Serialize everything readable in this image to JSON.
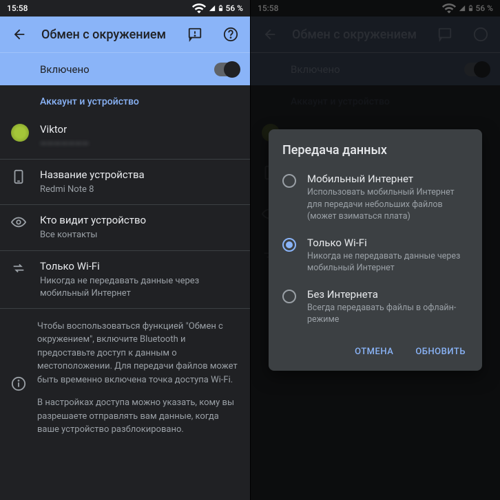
{
  "status": {
    "time": "15:58",
    "battery": "56 %"
  },
  "appbar": {
    "title": "Обмен с окружением"
  },
  "enabled": {
    "label": "Включено"
  },
  "section": {
    "account": "Аккаунт и устройство"
  },
  "rows": {
    "user": {
      "name": "Viktor",
      "email": "———————"
    },
    "device": {
      "title": "Название устройства",
      "sub": "Redmi Note 8"
    },
    "visibility": {
      "title": "Кто видит устройство",
      "sub": "Все контакты"
    },
    "datausage": {
      "title": "Только Wi-Fi",
      "sub": "Никогда не передавать данные через мобильный Интернет"
    }
  },
  "info": {
    "p1": "Чтобы воспользоваться функцией \"Обмен с окружением\", включите Bluetooth и предоставьте доступ к данным о местоположении. Для передачи файлов может быть временно включена точка доступа Wi-Fi.",
    "p2": "В настройках доступа можно указать, кому вы разрешаете отправлять вам данные, когда ваше устройство разблокировано."
  },
  "dialog": {
    "title": "Передача данных",
    "options": [
      {
        "title": "Мобильный Интернет",
        "sub": "Использовать мобильный Интернет для передачи небольших файлов\n(может взиматься плата)",
        "selected": false
      },
      {
        "title": "Только Wi-Fi",
        "sub": "Никогда не передавать данные через мобильный Интернет",
        "selected": true
      },
      {
        "title": "Без Интернета",
        "sub": "Всегда передавать файлы в офлайн-режиме",
        "selected": false
      }
    ],
    "cancel": "ОТМЕНА",
    "update": "ОБНОВИТЬ"
  }
}
